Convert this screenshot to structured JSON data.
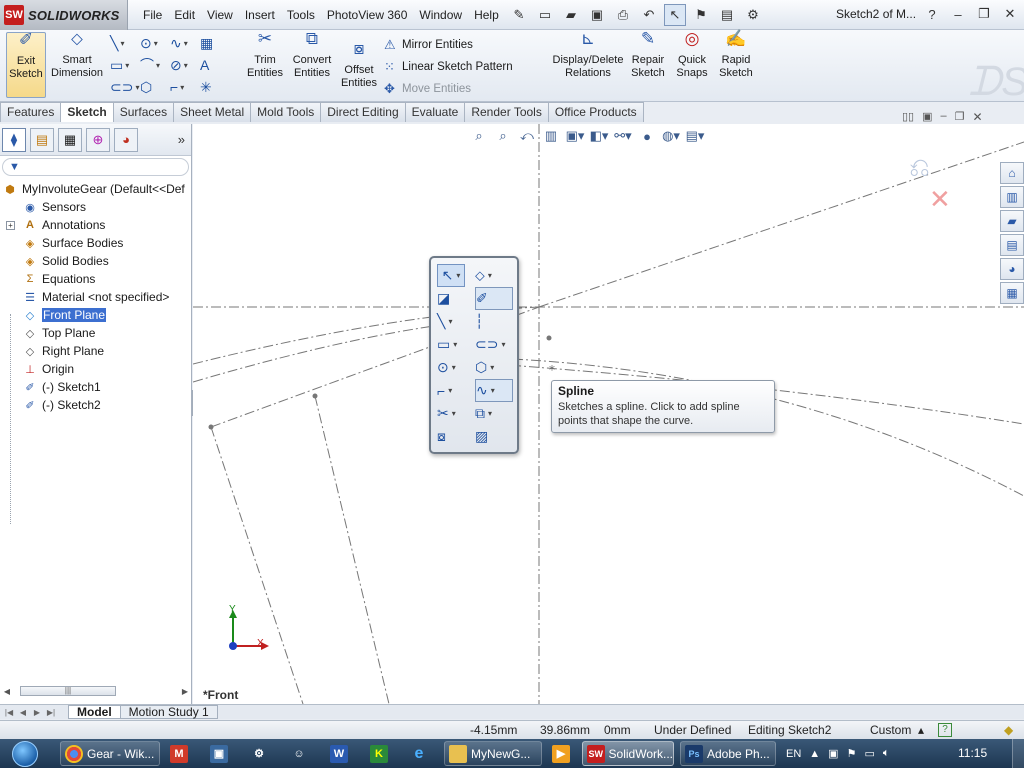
{
  "app": {
    "brand_mark": "SW",
    "brand_name": "SOLIDWORKS",
    "doc_title": "Sketch2 of M..."
  },
  "menu": [
    "File",
    "Edit",
    "View",
    "Insert",
    "Tools",
    "PhotoView 360",
    "Window",
    "Help"
  ],
  "commands": {
    "exit_sketch": "Exit Sketch",
    "smart_dimension": "Smart Dimension",
    "trim_entities": "Trim Entities",
    "convert_entities": "Convert Entities",
    "offset_entities": "Offset Entities",
    "mirror_entities": "Mirror Entities",
    "linear_sketch_pattern": "Linear Sketch Pattern",
    "move_entities": "Move Entities",
    "display_delete_relations": "Display/Delete Relations",
    "repair_sketch": "Repair Sketch",
    "quick_snaps": "Quick Snaps",
    "rapid_sketch": "Rapid Sketch"
  },
  "tabs": [
    "Features",
    "Sketch",
    "Surfaces",
    "Sheet Metal",
    "Mold Tools",
    "Direct Editing",
    "Evaluate",
    "Render Tools",
    "Office Products"
  ],
  "active_tab": "Sketch",
  "tree": {
    "root": "MyInvoluteGear  (Default<<Def",
    "items": [
      {
        "label": "Sensors",
        "icon": "sensor-icon"
      },
      {
        "label": "Annotations",
        "icon": "annotation-icon"
      },
      {
        "label": "Surface Bodies",
        "icon": "surface-bodies-icon"
      },
      {
        "label": "Solid Bodies",
        "icon": "solid-bodies-icon"
      },
      {
        "label": "Equations",
        "icon": "equations-icon"
      },
      {
        "label": "Material <not specified>",
        "icon": "material-icon"
      },
      {
        "label": "Front Plane",
        "icon": "plane-icon"
      },
      {
        "label": "Top Plane",
        "icon": "plane-icon"
      },
      {
        "label": "Right Plane",
        "icon": "plane-icon"
      },
      {
        "label": "Origin",
        "icon": "origin-icon"
      },
      {
        "label": "(-) Sketch1",
        "icon": "sketch-icon"
      },
      {
        "label": "(-) Sketch2",
        "icon": "sketch-icon"
      }
    ],
    "selected": "Front Plane"
  },
  "viewport": {
    "view_label": "*Front",
    "triad_x": "X",
    "triad_y": "Y"
  },
  "tooltip": {
    "title": "Spline",
    "text": "Sketches a spline. Click to add spline points that shape the curve."
  },
  "model_tabs": [
    "Model",
    "Motion Study 1"
  ],
  "status": {
    "x": "-4.15mm",
    "y": "39.86mm",
    "z": "0mm",
    "state": "Under Defined",
    "editing": "Editing Sketch2",
    "units": "Custom"
  },
  "taskbar": {
    "items": [
      {
        "label": "Gear - Wik...",
        "icon": "chrome-icon"
      },
      {
        "label": "MyNewG...",
        "icon": "folder-icon"
      },
      {
        "label": "SolidWork...",
        "icon": "solidworks-icon"
      },
      {
        "label": "Adobe Ph...",
        "icon": "photoshop-icon"
      }
    ],
    "lang": "EN",
    "time": "11:15"
  },
  "colors": {
    "accent": "#3c6fd0",
    "brand_red": "#c41e1e",
    "taskbar": "#1d3651"
  }
}
